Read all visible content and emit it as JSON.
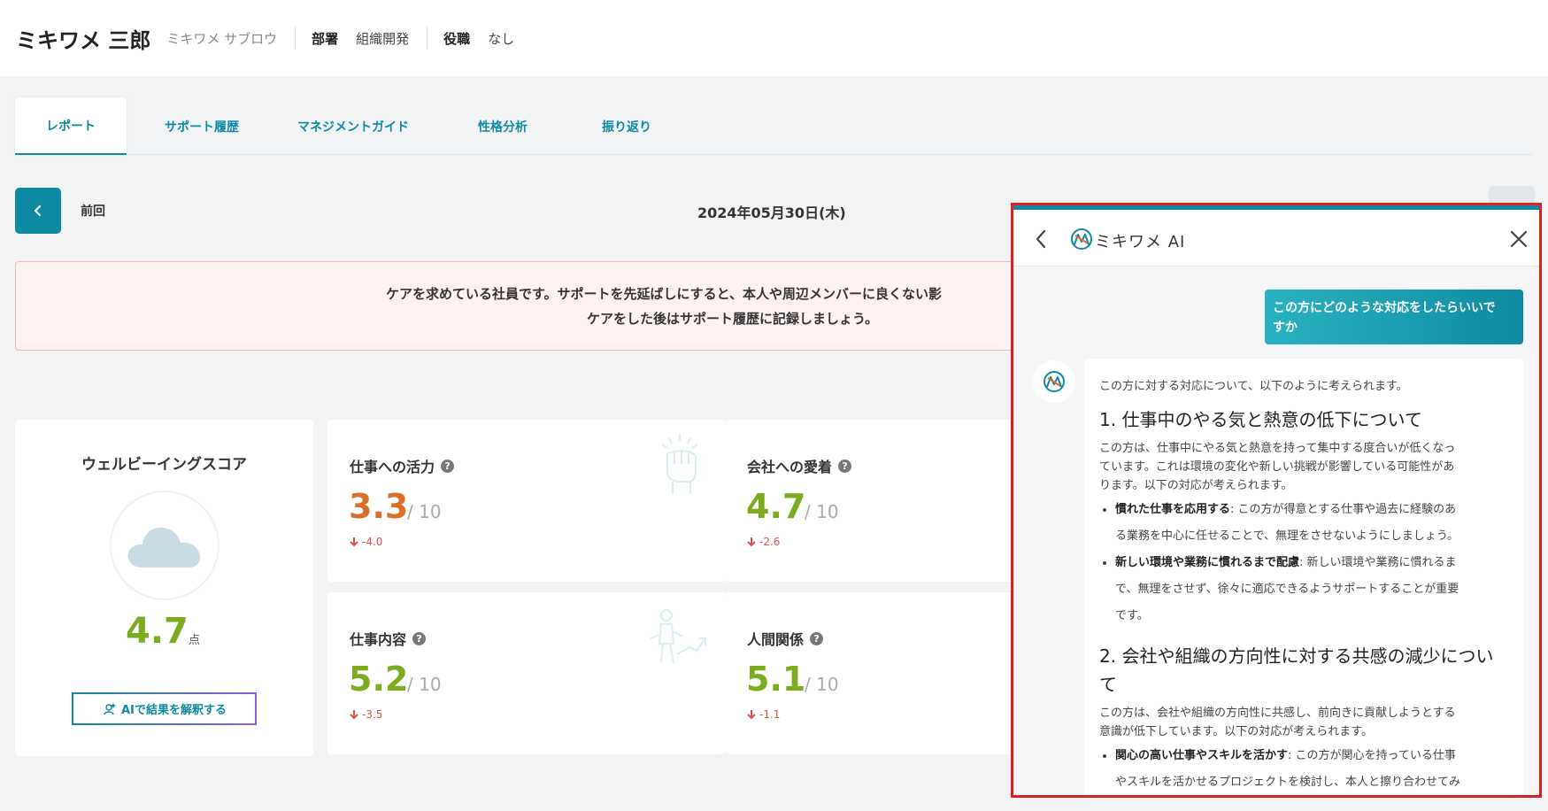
{
  "header": {
    "name": "ミキワメ 三郎",
    "name_kana": "ミキワメ サブロウ",
    "department_label": "部署",
    "department_value": "組織開発",
    "position_label": "役職",
    "position_value": "なし"
  },
  "tabs": [
    {
      "label": "レポート",
      "active": true
    },
    {
      "label": "サポート履歴"
    },
    {
      "label": "マネジメントガイド"
    },
    {
      "label": "性格分析"
    },
    {
      "label": "振り返り"
    }
  ],
  "nav": {
    "prev_label": "前回",
    "date": "2024年05月30日(木)"
  },
  "alert": {
    "line1": "ケアを求めている社員です。サポートを先延ばしにすると、本人や周辺メンバーに良くない影",
    "line2": "ケアをした後はサポート履歴に記録しましょう。"
  },
  "wellbeing": {
    "title": "ウェルビーイングスコア",
    "score": "4.7",
    "unit": "点",
    "icon": "cloud-icon",
    "ai_button_label": "AIで結果を解釈する"
  },
  "metrics": [
    {
      "title": "仕事への活力",
      "value": "3.3",
      "denom": "/ 10",
      "delta": "-4.0",
      "color": "#d6702a",
      "icon": "fist-icon"
    },
    {
      "title": "会社への愛着",
      "value": "4.7",
      "denom": "/ 10",
      "delta": "-2.6",
      "color": "#7bab1e"
    },
    {
      "title": "仕事内容",
      "value": "5.2",
      "denom": "/ 10",
      "delta": "-3.5",
      "color": "#7bab1e",
      "icon": "climbing-person-icon"
    },
    {
      "title": "人間関係",
      "value": "5.1",
      "denom": "/ 10",
      "delta": "-1.1",
      "color": "#7bab1e"
    }
  ],
  "ai_panel": {
    "title": "ミキワメ AI",
    "user_message_line1": "この方にどのような対応をしたらいいで",
    "user_message_line2": "すか",
    "intro": "この方に対する対応について、以下のように考えられます。",
    "section1": {
      "heading": "1. 仕事中のやる気と熱意の低下について",
      "para_lines": [
        "この方は、仕事中にやる気と熱意を持って集中する度合いが低くなっ",
        "ています。これは環境の変化や新しい挑戦が影響している可能性があ",
        "ります。以下の対応が考えられます。"
      ],
      "items": [
        {
          "bold": "慣れた仕事を応用する",
          "lines": [
            ": この方が得意とする仕事や過去に経験のあ",
            "る業務を中心に任せることで、無理をさせないようにしましょう。"
          ]
        },
        {
          "bold": "新しい環境や業務に慣れるまで配慮",
          "lines": [
            ": 新しい環境や業務に慣れるま",
            "で、無理をさせず、徐々に適応できるようサポートすることが重要",
            "です。"
          ]
        }
      ]
    },
    "section2": {
      "heading_line1": "2. 会社や組織の方向性に対する共感の減少につい",
      "heading_line2": "て",
      "para_lines": [
        "この方は、会社や組織の方向性に共感し、前向きに貢献しようとする",
        "意識が低下しています。以下の対応が考えられます。"
      ],
      "items": [
        {
          "bold": "関心の高い仕事やスキルを活かす",
          "lines": [
            ": この方が関心を持っている仕事",
            "やスキルを活かせるプロジェクトを検討し、本人と擦り合わせてみ"
          ]
        }
      ]
    }
  }
}
